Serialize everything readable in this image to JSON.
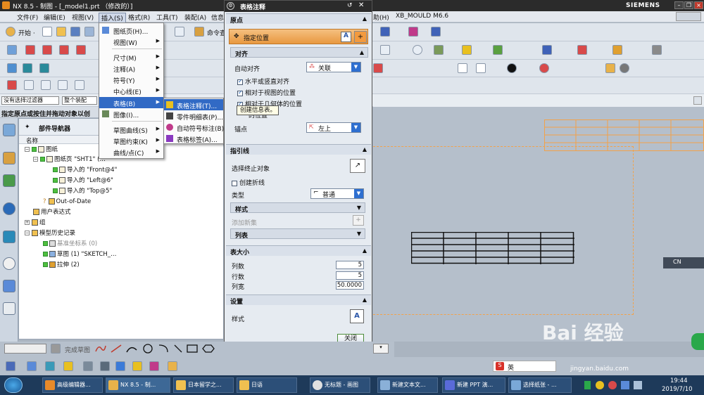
{
  "window": {
    "title": "NX 8.5 - 制图 - [_model1.prt （修改的）]",
    "brand": "SIEMENS"
  },
  "menubar": {
    "items": [
      "文件(F)",
      "编辑(E)",
      "视图(V)",
      "插入(S)",
      "格式(R)",
      "工具(T)",
      "装配(A)",
      "信息",
      "助(H)",
      "XB_MOULD M6.6"
    ]
  },
  "toolbar": {
    "start_label": "开始 ·",
    "command_label": "命令查"
  },
  "filter": {
    "value": "没有选择过滤器",
    "assembly": "整个装配"
  },
  "prompt": "指定原点或按住并拖动对象以创",
  "insert_menu": {
    "items": [
      {
        "label": "图纸页(H)...",
        "arrow": false
      },
      {
        "label": "视图(W)",
        "arrow": true
      },
      {
        "label": "尺寸(M)",
        "arrow": true
      },
      {
        "label": "注释(A)",
        "arrow": true
      },
      {
        "label": "符号(Y)",
        "arrow": true
      },
      {
        "label": "中心线(E)",
        "arrow": true
      },
      {
        "label": "表格(B)",
        "arrow": true
      },
      {
        "label": "图像(I)...",
        "arrow": false
      },
      {
        "label": "草图曲线(S)",
        "arrow": true
      },
      {
        "label": "草图约束(K)",
        "arrow": true
      },
      {
        "label": "曲线/点(C)",
        "arrow": true
      }
    ]
  },
  "table_submenu": {
    "items": [
      "表格注释(T)...",
      "零件明细表(P)...",
      "自动符号标注(B)",
      "表格标签(A)..."
    ]
  },
  "tooltip": "创建信息表。",
  "navigator": {
    "title": "部件导航器",
    "column": "名称",
    "nodes": [
      "图纸",
      "图纸页 \"SHT1\" (…",
      "导入的 \"Front@4\"",
      "导入的 \"Left@6\"",
      "导入的 \"Top@5\"",
      "Out-of-Date",
      "用户表达式",
      "组",
      "模型历史记录",
      "基准坐标系 (0)",
      "草图 (1) \"SKETCH_…",
      "拉伸 (2)"
    ]
  },
  "dialog": {
    "title": "表格注释",
    "origin": {
      "header": "原点",
      "specify_location": "指定位置",
      "align_header": "对齐",
      "auto_align_label": "自动对齐",
      "auto_align_value": "关联",
      "opt1": "水平或竖直对齐",
      "opt2": "相对于视图的位置",
      "opt3": "相对于几何体的位置",
      "opt4": "的位置",
      "anchor_label": "锚点",
      "anchor_value": "左上"
    },
    "leader": {
      "header": "指引线",
      "select_end": "选择终止对象",
      "create_jog": "创建折线",
      "type_label": "类型",
      "type_value": "普通",
      "style": "样式",
      "add_new": "添加新集",
      "list": "列表"
    },
    "table_size": {
      "header": "表大小",
      "cols_label": "列数",
      "cols": "5",
      "rows_label": "行数",
      "rows": "5",
      "width_label": "列宽",
      "width": "50.0000"
    },
    "settings": {
      "header": "设置",
      "style_label": "样式"
    },
    "close": "关闭"
  },
  "sketch_toolbar": {
    "label": "完成草图"
  },
  "lang": {
    "cn": "CN"
  },
  "ime": {
    "label": "英"
  },
  "watermark": {
    "text": "Bai 经验",
    "url": "jingyan.baidu.com"
  },
  "taskbar": {
    "items": [
      "高级编辑器...",
      "NX 8.5 - 制...",
      "日本留学之...",
      "日语",
      "无标题 - 画图",
      "新建文本文...",
      "新建 PPT 演...",
      "选择纸张 - ..."
    ],
    "time": "19:44",
    "date": "2019/7/10"
  },
  "colors": {
    "accent": "#316ac5",
    "orange": "#f2a24a",
    "titlebar": "#2b2b2b",
    "taskbar": "#1e3a5a"
  }
}
